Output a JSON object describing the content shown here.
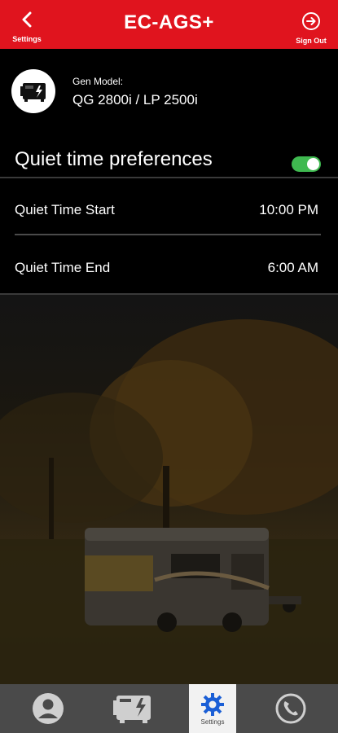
{
  "header": {
    "title": "EC-AGS+",
    "back_label": "Settings",
    "signout_label": "Sign Out",
    "bg_color": "#e0141e"
  },
  "generator": {
    "label": "Gen Model:",
    "model": "QG 2800i / LP 2500i",
    "icon": "generator-icon"
  },
  "quiet_time": {
    "heading": "Quiet time preferences",
    "enabled": true,
    "toggle_color": "#3fb950",
    "start_label": "Quiet Time Start",
    "start_value": "10:00 PM",
    "end_label": "Quiet Time End",
    "end_value": "6:00 AM"
  },
  "tabbar": {
    "tabs": [
      {
        "icon": "user-icon",
        "label": ""
      },
      {
        "icon": "generator-icon",
        "label": ""
      },
      {
        "icon": "gear-icon",
        "label": "Settings",
        "active": true
      },
      {
        "icon": "phone-icon",
        "label": ""
      }
    ],
    "accent_color": "#1b5fd6"
  }
}
